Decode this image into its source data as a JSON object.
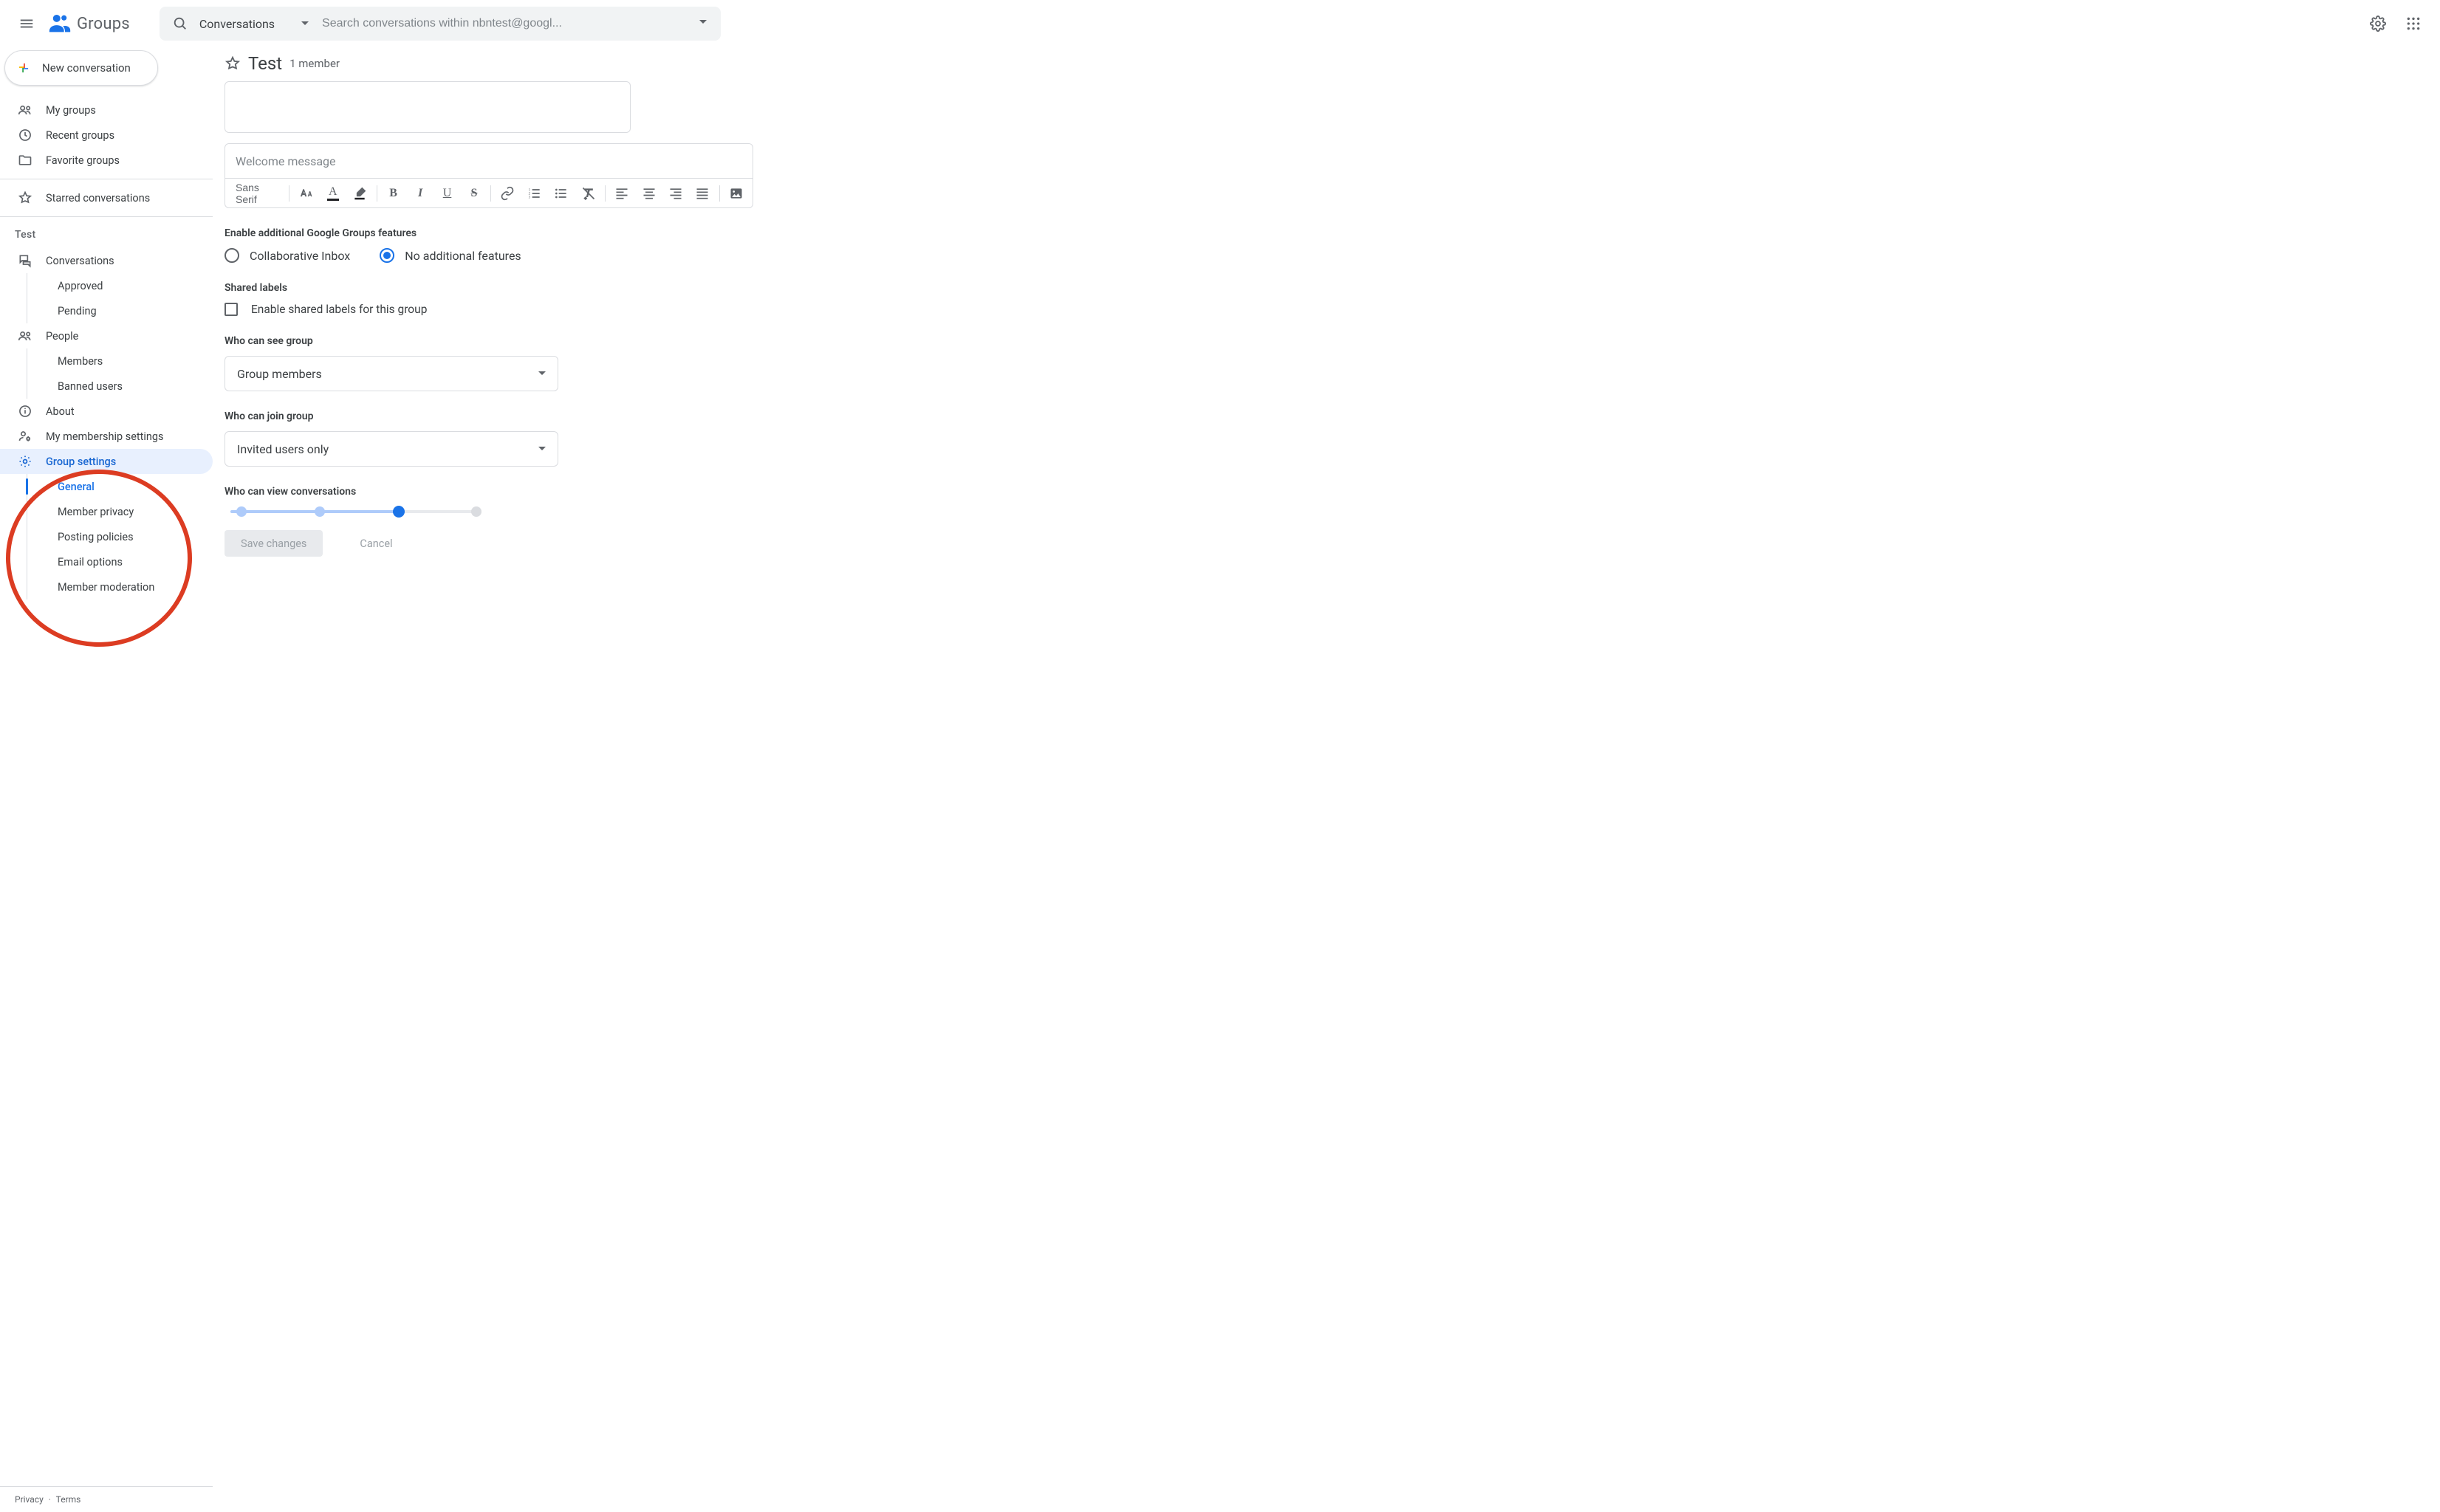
{
  "brand": {
    "word": "Groups"
  },
  "search": {
    "scope": "Conversations",
    "placeholder": "Search conversations within nbntest@googl..."
  },
  "compose_label": "New conversation",
  "sidebar": {
    "top": [
      {
        "label": "My groups",
        "icon": "group"
      },
      {
        "label": "Recent groups",
        "icon": "clock"
      },
      {
        "label": "Favorite groups",
        "icon": "folder-star"
      }
    ],
    "starred": "Starred conversations",
    "section": "Test",
    "items": {
      "conversations": "Conversations",
      "approved": "Approved",
      "pending": "Pending",
      "people": "People",
      "members": "Members",
      "banned": "Banned users",
      "about": "About",
      "membership": "My membership settings",
      "group_settings": "Group settings",
      "general": "General",
      "privacy": "Member privacy",
      "posting": "Posting policies",
      "email": "Email options",
      "moderation": "Member moderation"
    }
  },
  "footer": {
    "privacy": "Privacy",
    "terms": "Terms"
  },
  "page": {
    "title": "Test",
    "members": "1 member",
    "welcome_placeholder": "Welcome message",
    "font": "Sans Serif",
    "features_label": "Enable additional Google Groups features",
    "feat_collab": "Collaborative Inbox",
    "feat_none": "No additional features",
    "shared_labels_header": "Shared labels",
    "shared_labels_opt": "Enable shared labels for this group",
    "see_label": "Who can see group",
    "see_value": "Group members",
    "join_label": "Who can join group",
    "join_value": "Invited users only",
    "view_label": "Who can view conversations",
    "save": "Save changes",
    "cancel": "Cancel"
  }
}
